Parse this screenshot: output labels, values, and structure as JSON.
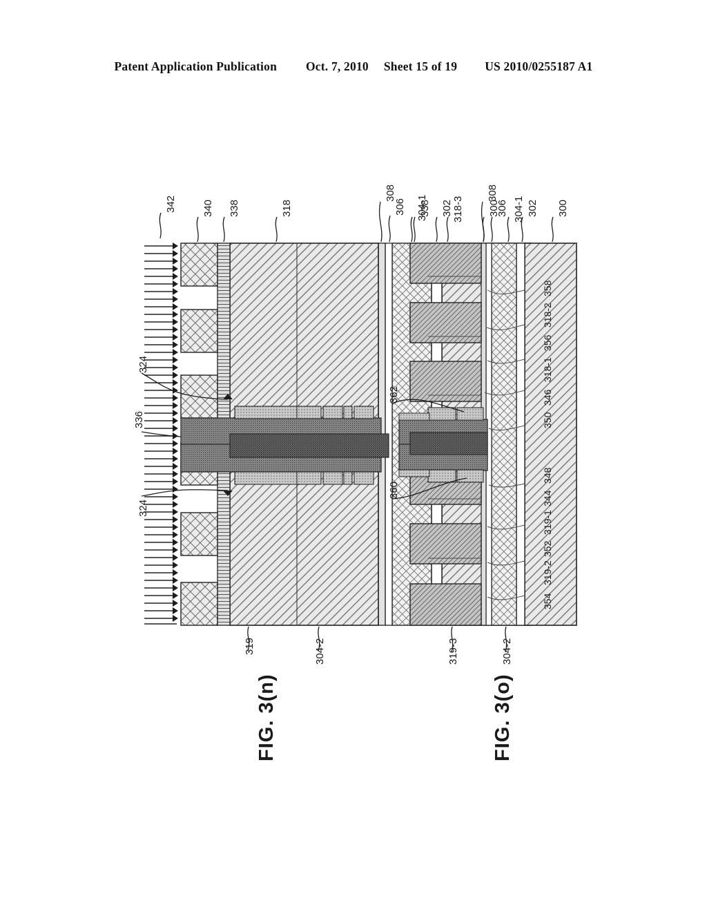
{
  "header": {
    "publication": "Patent Application Publication",
    "date": "Oct. 7, 2010",
    "sheet": "Sheet 15 of 19",
    "number": "US 2010/0255187 A1"
  },
  "figures": [
    {
      "id": "fig-3n",
      "caption": "FIG. 3(n)",
      "top_labels": [
        "342",
        "340",
        "338",
        "318",
        "308",
        "306",
        "304-1",
        "302",
        "300"
      ],
      "left_labels": [
        "324",
        "336",
        "324"
      ],
      "bottom_labels": [
        "319",
        "304-2"
      ]
    },
    {
      "id": "fig-3o",
      "caption": "FIG. 3(o)",
      "top_labels": [
        "338",
        "318-3",
        "308",
        "306",
        "304-1",
        "302",
        "300"
      ],
      "inner_labels": [
        "362",
        "360"
      ],
      "stack_labels": [
        "354",
        "319-2",
        "352",
        "319-1",
        "344",
        "348",
        "350",
        "346",
        "318-1",
        "356",
        "318-2",
        "358"
      ],
      "bottom_labels": [
        "319-3",
        "304-2"
      ]
    }
  ],
  "colors": {
    "ink": "#1a1a1a",
    "line": "#222222",
    "paper": "#ffffff",
    "fill_light": "#d8d8d8",
    "fill_mid": "#b8b8b8",
    "fill_dark": "#8e8e8e"
  }
}
